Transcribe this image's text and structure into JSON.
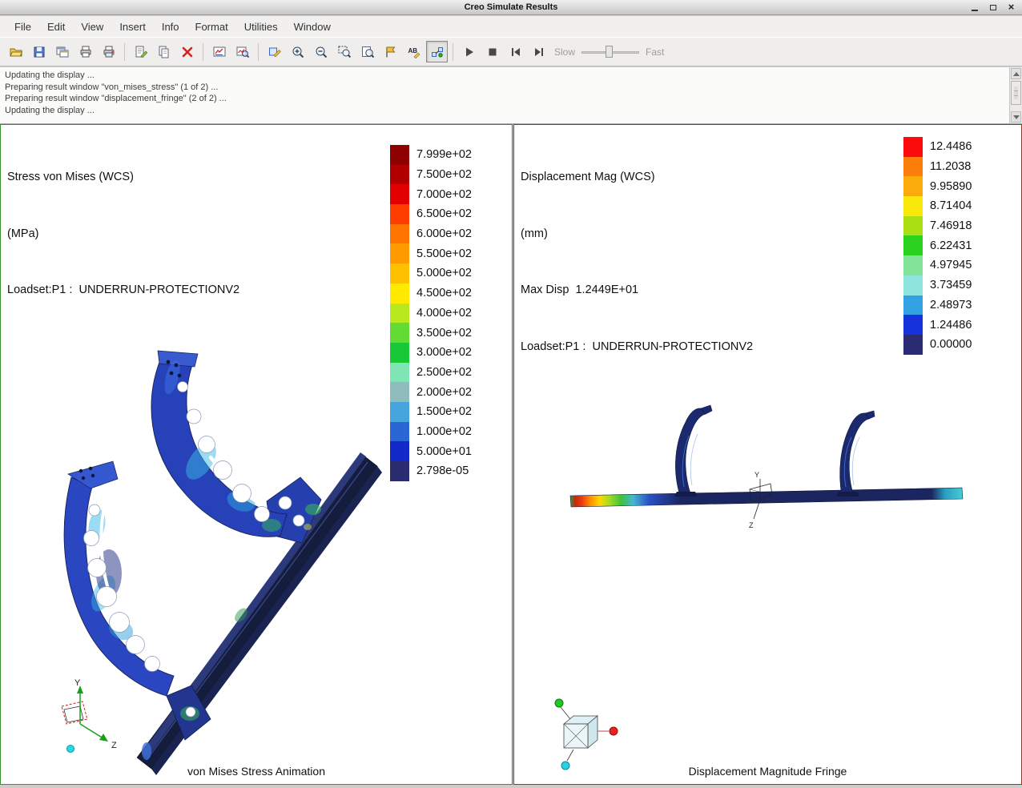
{
  "window": {
    "title": "Creo Simulate Results"
  },
  "menu": {
    "items": [
      "File",
      "Edit",
      "View",
      "Insert",
      "Info",
      "Format",
      "Utilities",
      "Window"
    ]
  },
  "toolbar": {
    "slow": "Slow",
    "fast": "Fast",
    "ab": "AB",
    "button_names": [
      "open",
      "save",
      "save-a-copy",
      "print",
      "print-options",
      "edit-report",
      "copy",
      "delete",
      "result-window",
      "review-results",
      "format-result",
      "zoom-in",
      "zoom-out",
      "zoom-box",
      "zoom-refit",
      "tag",
      "annotate",
      "animate",
      "play",
      "stop",
      "previous-frame",
      "next-frame"
    ]
  },
  "messages": {
    "lines": [
      "Updating the display ...",
      "Preparing result window \"von_mises_stress\" (1 of 2) ...",
      "Preparing result window \"displacement_fringe\" (2 of 2) ...",
      "Updating the display ..."
    ]
  },
  "left_window": {
    "title": "Stress von Mises (WCS)",
    "units": "(MPa)",
    "loadset": "Loadset:P1 :  UNDERRUN-PROTECTIONV2",
    "caption": "von Mises Stress Animation",
    "triad": {
      "y": "Y",
      "z": "Z"
    },
    "legend": [
      {
        "value": "7.999e+02",
        "color": "#8e0000"
      },
      {
        "value": "7.500e+02",
        "color": "#b20000"
      },
      {
        "value": "7.000e+02",
        "color": "#e30000"
      },
      {
        "value": "6.500e+02",
        "color": "#ff3c00"
      },
      {
        "value": "6.000e+02",
        "color": "#ff7300"
      },
      {
        "value": "5.500e+02",
        "color": "#ff9a00"
      },
      {
        "value": "5.000e+02",
        "color": "#ffc000"
      },
      {
        "value": "4.500e+02",
        "color": "#ffe900"
      },
      {
        "value": "4.000e+02",
        "color": "#b8e81e"
      },
      {
        "value": "3.500e+02",
        "color": "#63db35"
      },
      {
        "value": "3.000e+02",
        "color": "#17c837"
      },
      {
        "value": "2.500e+02",
        "color": "#7fe5b4"
      },
      {
        "value": "2.000e+02",
        "color": "#8fbcbc"
      },
      {
        "value": "1.500e+02",
        "color": "#47a5dd"
      },
      {
        "value": "1.000e+02",
        "color": "#2a66d4"
      },
      {
        "value": "5.000e+01",
        "color": "#1429c9"
      },
      {
        "value": "2.798e-05",
        "color": "#2b2b70"
      }
    ]
  },
  "right_window": {
    "title": "Displacement Mag (WCS)",
    "units": "(mm)",
    "max_disp": "Max Disp  1.2449E+01",
    "loadset": "Loadset:P1 :  UNDERRUN-PROTECTIONV2",
    "caption": "Displacement Magnitude Fringe",
    "triad": {
      "y": "Y",
      "z": "Z"
    },
    "legend": [
      {
        "value": "12.4486",
        "color": "#fb0b0b"
      },
      {
        "value": "11.2038",
        "color": "#fb7e0b"
      },
      {
        "value": "9.95890",
        "color": "#fbab0b"
      },
      {
        "value": "8.71404",
        "color": "#fbe80b"
      },
      {
        "value": "7.46918",
        "color": "#aadf14"
      },
      {
        "value": "6.22431",
        "color": "#2bd21f"
      },
      {
        "value": "4.97945",
        "color": "#83e398"
      },
      {
        "value": "3.73459",
        "color": "#8fe5dd"
      },
      {
        "value": "2.48973",
        "color": "#33a2e5"
      },
      {
        "value": "1.24486",
        "color": "#1532dc"
      },
      {
        "value": "0.00000",
        "color": "#2b2b74"
      }
    ]
  }
}
